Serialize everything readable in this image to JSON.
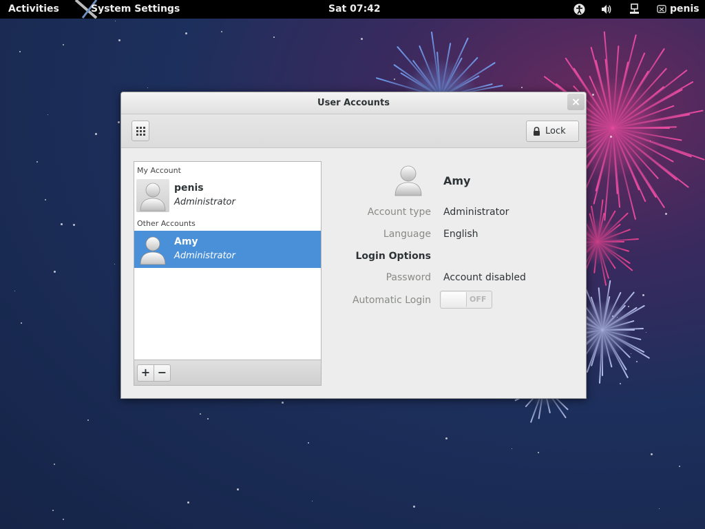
{
  "topbar": {
    "activities": "Activities",
    "app_name": "System Settings",
    "clock": "Sat 07:42",
    "username": "penis",
    "icons": [
      "accessibility-icon",
      "volume-icon",
      "network-icon",
      "user-status-icon"
    ]
  },
  "window": {
    "title": "User Accounts",
    "close_glyph": "×",
    "lock_label": "Lock"
  },
  "user_list": {
    "my_account_header": "My Account",
    "other_accounts_header": "Other Accounts",
    "my_account": {
      "name": "penis",
      "role": "Administrator"
    },
    "other_accounts": [
      {
        "name": "Amy",
        "role": "Administrator",
        "selected": true
      }
    ],
    "add_label": "+",
    "remove_label": "−"
  },
  "detail": {
    "name": "Amy",
    "account_type_label": "Account type",
    "account_type_value": "Administrator",
    "language_label": "Language",
    "language_value": "English",
    "login_options_heading": "Login Options",
    "password_label": "Password",
    "password_value": "Account disabled",
    "automatic_login_label": "Automatic Login",
    "automatic_login_state": "OFF"
  },
  "colors": {
    "selection": "#4a90d9",
    "topbar": "#000000",
    "window_bg": "#ededed"
  }
}
